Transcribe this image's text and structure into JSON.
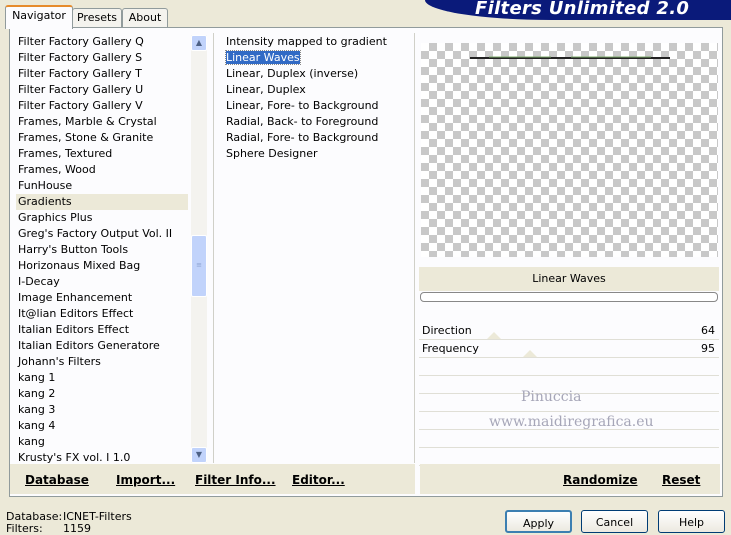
{
  "tabs": [
    {
      "label": "Navigator"
    },
    {
      "label": "Presets"
    },
    {
      "label": "About"
    }
  ],
  "banner_title": "Filters Unlimited 2.0",
  "categories": [
    "Filter Factory Gallery Q",
    "Filter Factory Gallery S",
    "Filter Factory Gallery T",
    "Filter Factory Gallery U",
    "Filter Factory Gallery V",
    "Frames, Marble & Crystal",
    "Frames, Stone & Granite",
    "Frames, Textured",
    "Frames, Wood",
    "FunHouse",
    "Gradients",
    "Graphics Plus",
    "Greg's Factory Output Vol. II",
    "Harry's Button Tools",
    "Horizonaus Mixed Bag",
    "I-Decay",
    "Image Enhancement",
    "It@lian Editors Effect",
    "Italian Editors Effect",
    "Italian Editors Generatore",
    "Johann's Filters",
    "kang 1",
    "kang 2",
    "kang 3",
    "kang 4",
    "kang",
    "Krusty's FX vol. I 1.0"
  ],
  "selected_category": "Gradients",
  "filters": [
    "Intensity mapped to gradient",
    "Linear Waves",
    "Linear, Duplex (inverse)",
    "Linear, Duplex",
    "Linear, Fore- to Background",
    "Radial, Back- to Foreground",
    "Radial, Fore- to Background",
    "Sphere Designer"
  ],
  "selected_filter": "Linear Waves",
  "filter_title": "Linear Waves",
  "params": [
    {
      "label": "Direction",
      "value": "64"
    },
    {
      "label": "Frequency",
      "value": "95"
    }
  ],
  "watermark": {
    "line1": "Pinuccia",
    "line2": "www.maidiregrafica.eu"
  },
  "bottom_links": {
    "database": "Database",
    "import": "Import...",
    "filter_info": "Filter Info...",
    "editor": "Editor...",
    "randomize": "Randomize",
    "reset": "Reset"
  },
  "status": {
    "database_label": "Database:",
    "database_value": "ICNET-Filters",
    "filters_label": "Filters:",
    "filters_value": "1159"
  },
  "buttons": {
    "apply": "Apply",
    "cancel": "Cancel",
    "help": "Help"
  },
  "colors": {
    "banner": "#0a1a7a",
    "selection": "#316ac5",
    "tab_accent": "#e68b2c"
  }
}
